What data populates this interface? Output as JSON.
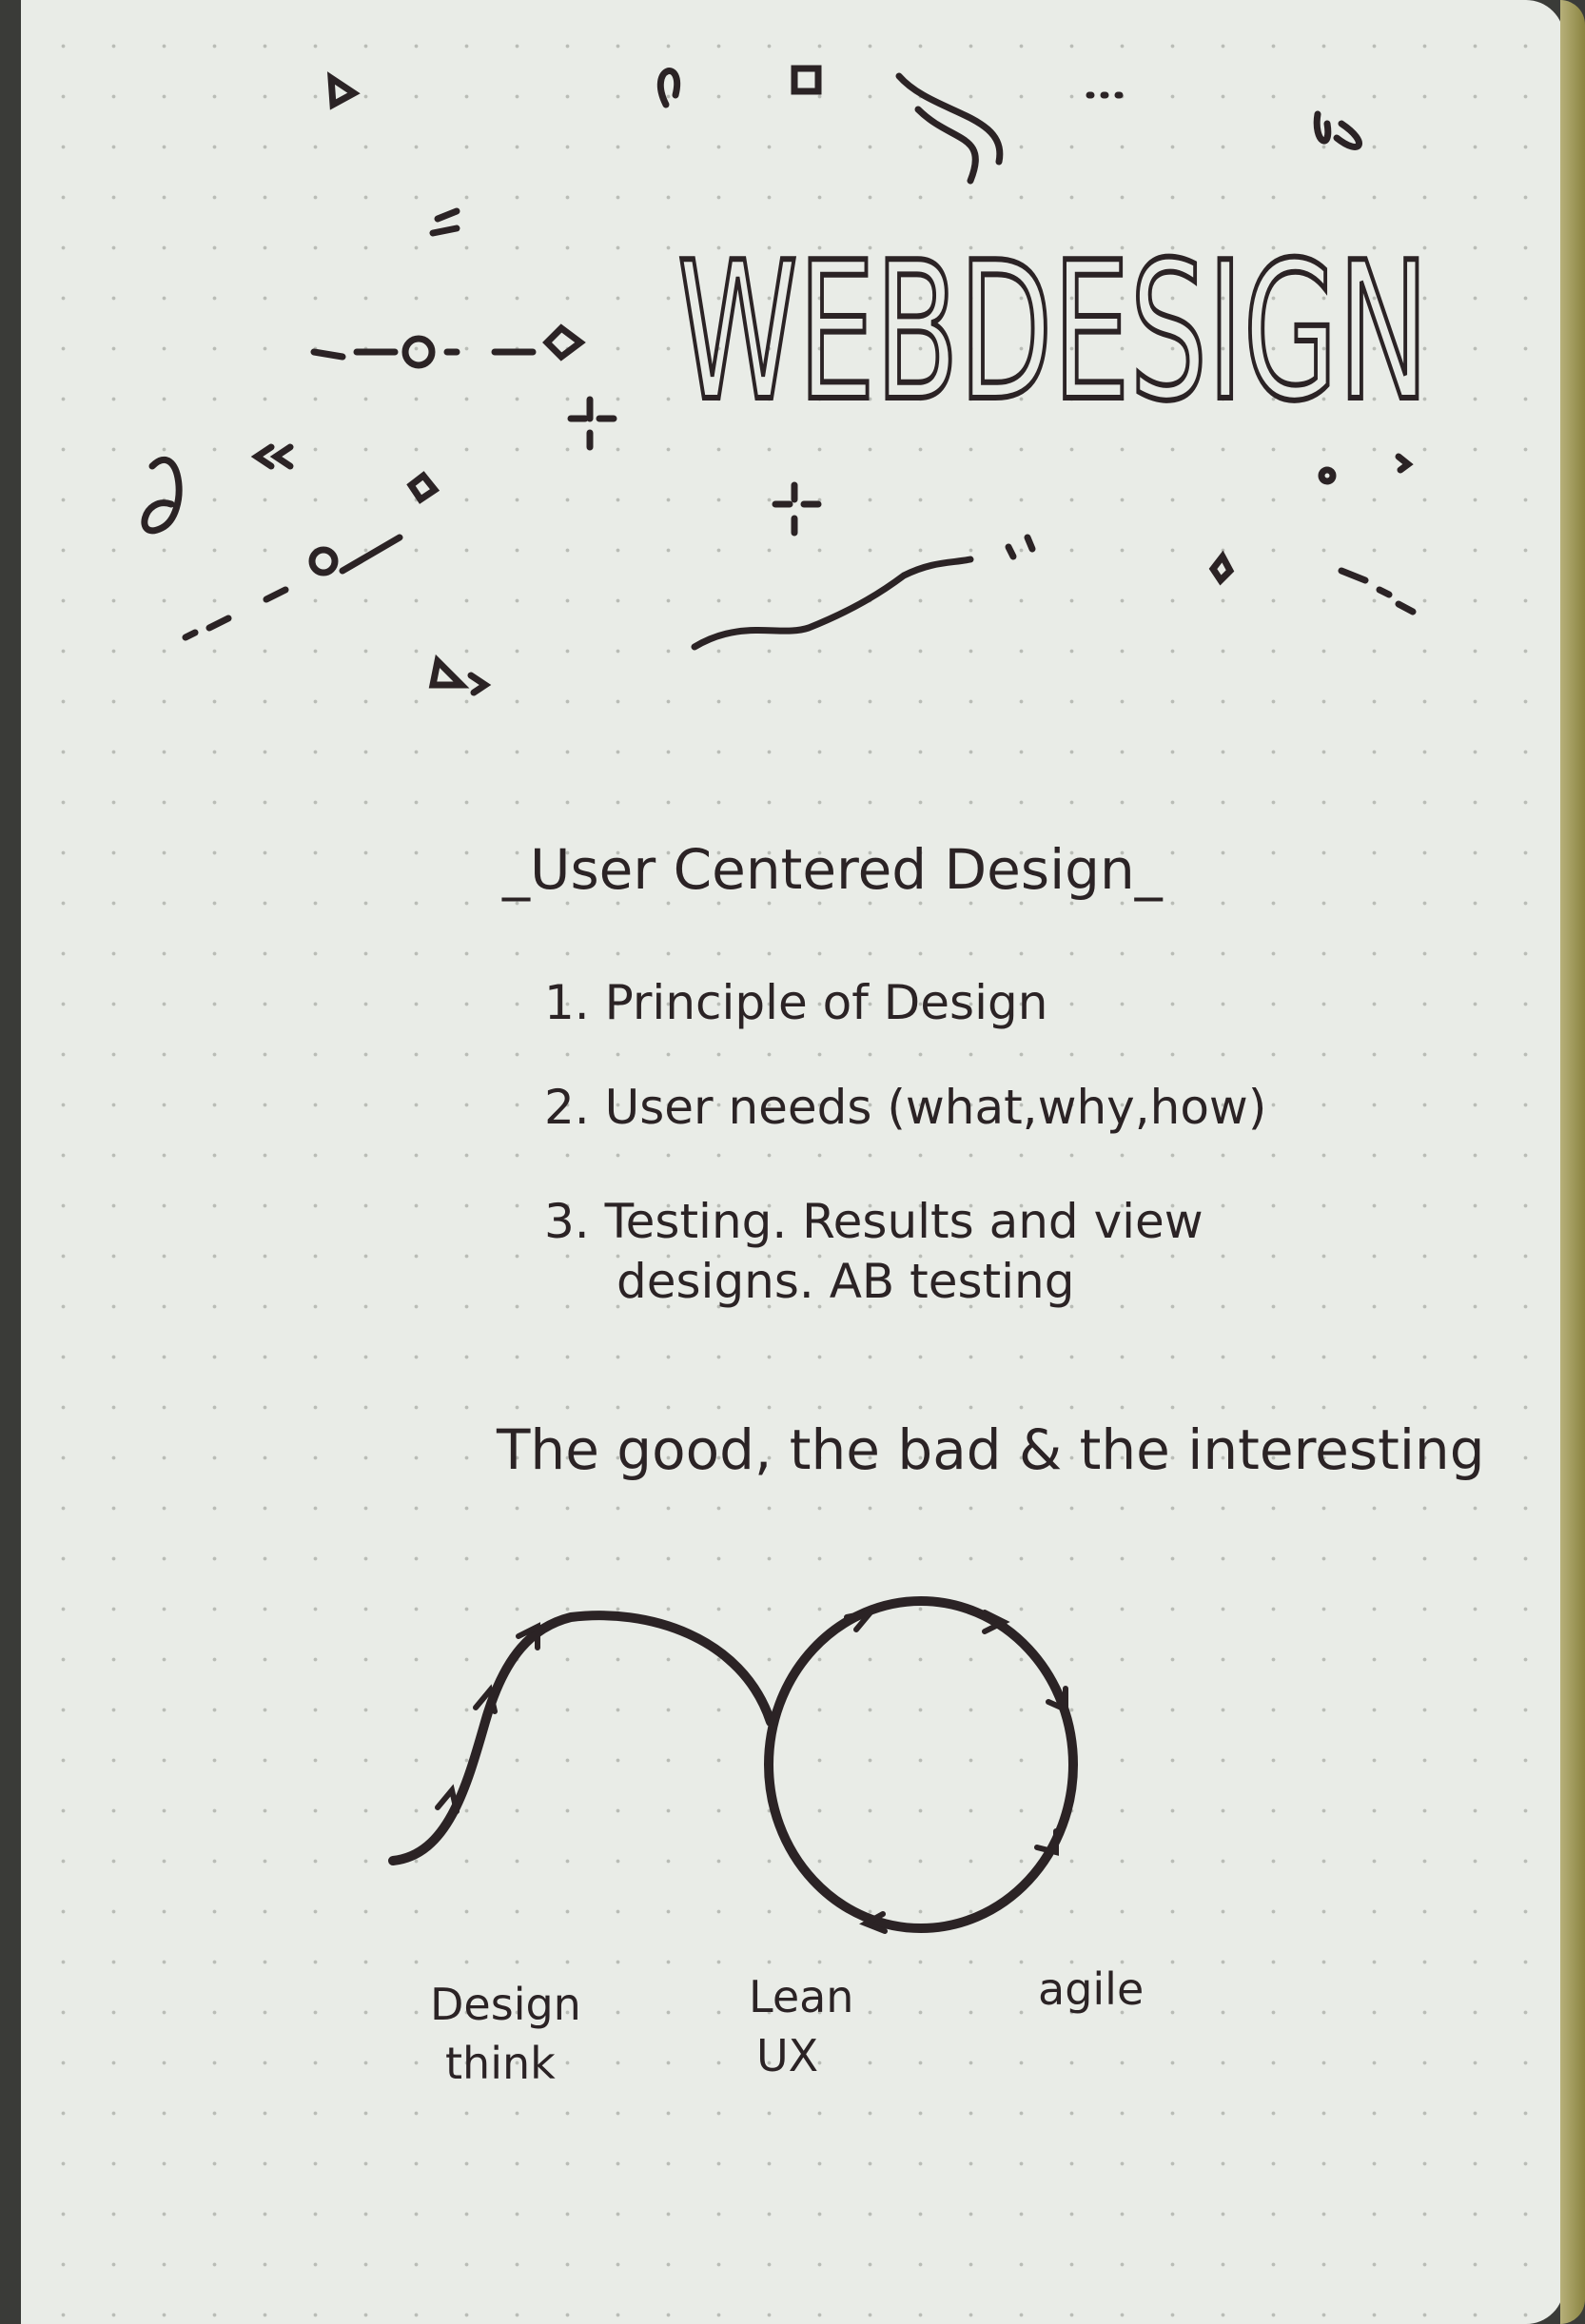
{
  "title": "WEBDESIGN",
  "section": {
    "heading": "_User Centered Design_",
    "items": [
      "1. Principle of Design",
      "2. User needs (what,why,how)",
      "3. Testing. Results and view",
      "designs. AB testing"
    ]
  },
  "subheading": "The good, the bad & the interesting",
  "diagram": {
    "labels": [
      "Design",
      "think",
      "Lean",
      "UX",
      "agile"
    ]
  },
  "colors": {
    "ink": "#2b2325",
    "paper": "#e9ece7",
    "edge": "#a39c5c"
  }
}
